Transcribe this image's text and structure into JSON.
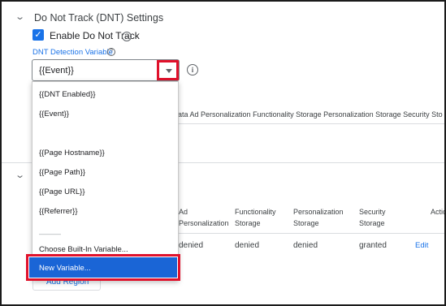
{
  "section": {
    "title": "Do Not Track (DNT) Settings",
    "enable_label": "Enable Do Not Track",
    "help_glyph": "?"
  },
  "dnt_variable": {
    "label": "DNT Detection Variable",
    "selected": "{{Event}}",
    "info_glyph": "i"
  },
  "table_header_bg": "er Data  Ad Personalization  Functionality Storage  Personalization Storage  Security Sto",
  "region_table": {
    "headers": [
      {
        "line1": "Ad",
        "line2": "Personalization"
      },
      {
        "line1": "Functionality",
        "line2": "Storage"
      },
      {
        "line1": "Personalization",
        "line2": "Storage"
      },
      {
        "line1": "Security",
        "line2": "Storage"
      },
      {
        "line1": "Actic",
        "line2": ""
      }
    ],
    "row": [
      "denied",
      "denied",
      "denied",
      "granted"
    ],
    "edit_label": "Edit"
  },
  "dropdown": {
    "options": [
      "{{DNT Enabled}}",
      "{{Event}}",
      "",
      "{{Page Hostname}}",
      "{{Page Path}}",
      "{{Page URL}}",
      "{{Referrer}}"
    ],
    "separator": "———",
    "builtin": "Choose Built-In Variable...",
    "new_variable": "New Variable..."
  },
  "add_region_label": "Add Region",
  "colors": {
    "accent": "#1a73e8",
    "highlight": "#e0112b",
    "selected_bg": "#1a65d6"
  }
}
